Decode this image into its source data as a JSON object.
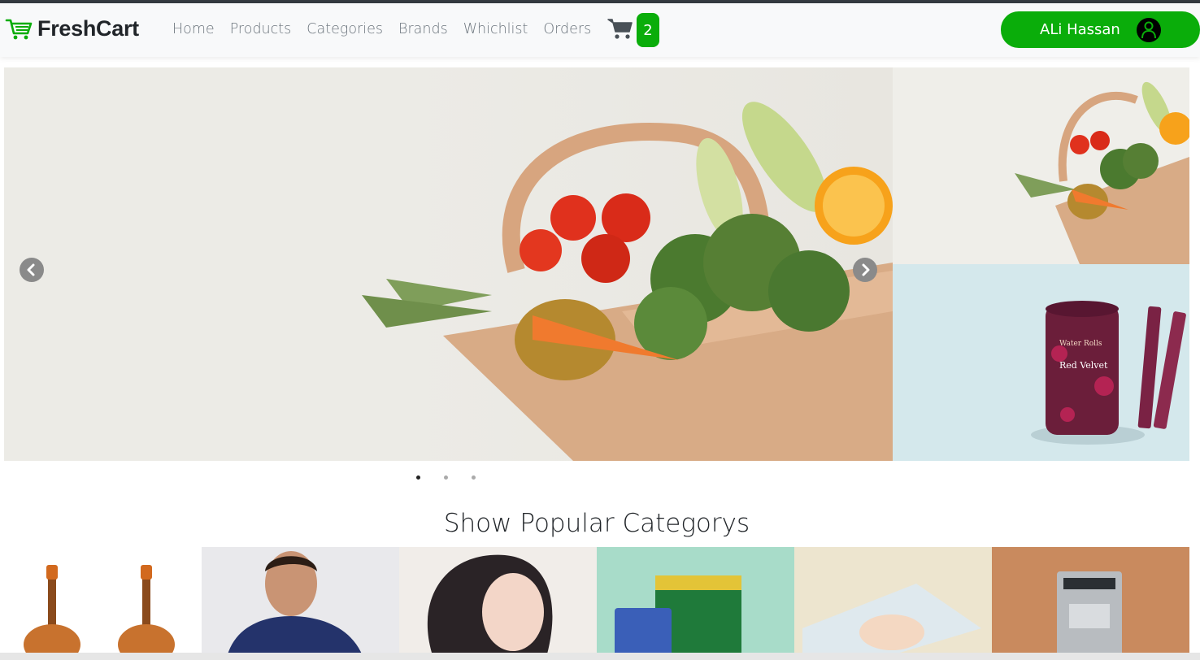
{
  "navbar": {
    "brand": "FreshCart",
    "links": [
      "Home",
      "Products",
      "Categories",
      "Brands",
      "Whichlist",
      "Orders"
    ],
    "cart_count": "2",
    "user_name": "ALi Hassan"
  },
  "colors": {
    "accent": "#0aad0a",
    "text": "#212529",
    "muted": "#6c757d"
  },
  "icons": {
    "logo": "cart-icon",
    "cart": "shopping-cart-icon",
    "user": "user-icon",
    "prev": "chevron-left-icon",
    "next": "chevron-right-icon"
  },
  "slider": {
    "dots_count": 3,
    "active_dot": 0
  },
  "side_product": {
    "brand_text": "Water Rolls",
    "flavor_text": "Red Velvet"
  },
  "categories_section": {
    "title": "Show Popular Categorys"
  }
}
